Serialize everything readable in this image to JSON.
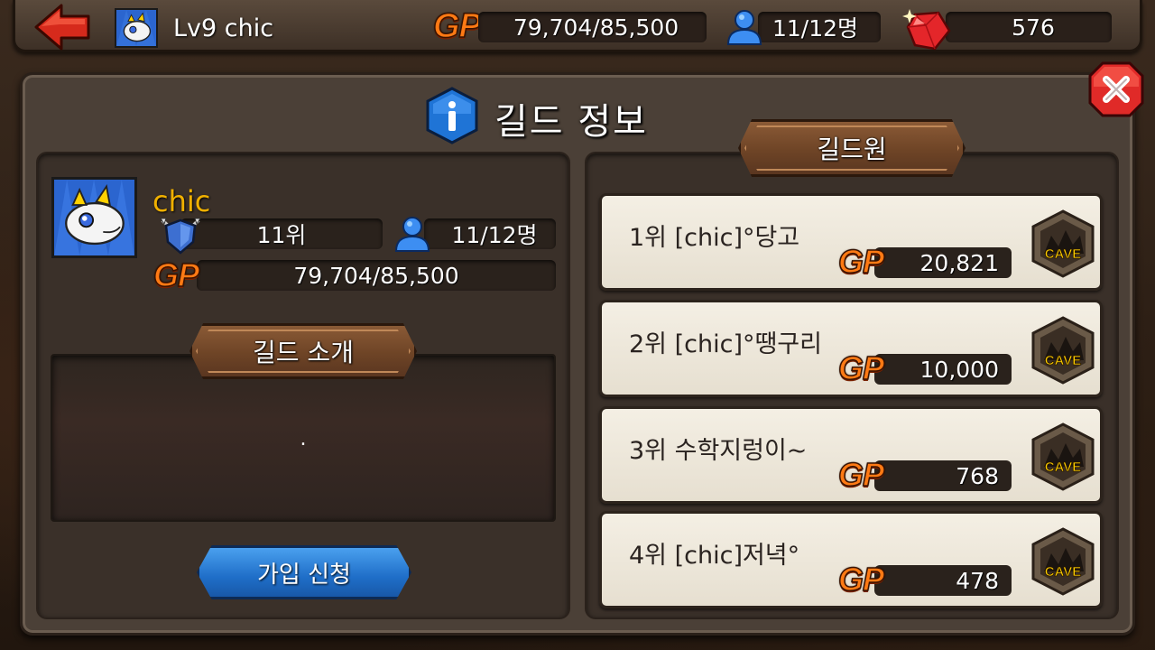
{
  "topbar": {
    "player_name": "Lv9 chic",
    "gp_logo": "GP",
    "gp_value": "79,704/85,500",
    "members_value": "11/12명",
    "gems_value": "576"
  },
  "panel": {
    "title": "길드 정보"
  },
  "guild": {
    "name": "chic",
    "rank": "11위",
    "members": "11/12명",
    "gp_logo": "GP",
    "gp_value": "79,704/85,500",
    "intro_header": "길드 소개",
    "intro_text": ".",
    "join_button": "가입 신청"
  },
  "members_header": "길드원",
  "members": [
    {
      "name": "1위 [chic]°당고",
      "gp_logo": "GP",
      "gp": "20,821",
      "badge": "CAVE"
    },
    {
      "name": "2위 [chic]°땡구리",
      "gp_logo": "GP",
      "gp": "10,000",
      "badge": "CAVE"
    },
    {
      "name": "3위 수학지렁이~",
      "gp_logo": "GP",
      "gp": "768",
      "badge": "CAVE"
    },
    {
      "name": "4위 [chic]저녁°",
      "gp_logo": "GP",
      "gp": "478",
      "badge": "CAVE"
    }
  ],
  "colors": {
    "panel_bg": "#4b4037",
    "gp_orange": "#ff7a14",
    "guild_name": "#f0b000",
    "join_blue": "#1f6ec8",
    "card_bg": "#f4efe4"
  },
  "icons": [
    "back-arrow-icon",
    "dragon-avatar-icon",
    "member-icon",
    "ruby-gem-icon",
    "close-icon",
    "info-icon",
    "guild-rank-shield-icon",
    "cave-badge-icon"
  ]
}
